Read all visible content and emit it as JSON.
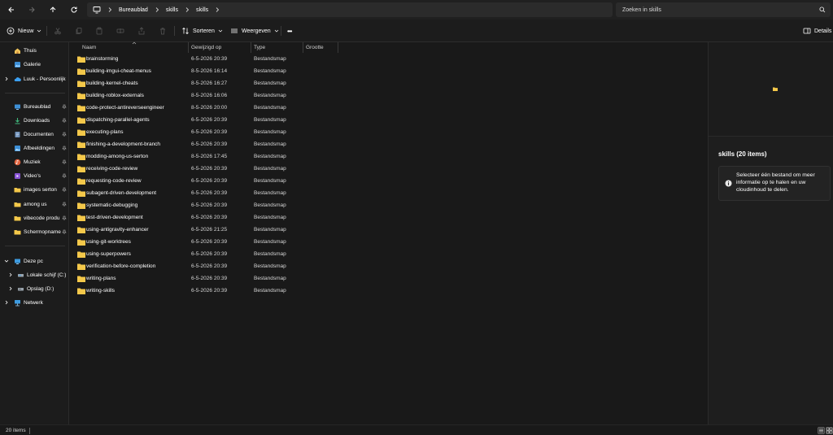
{
  "addressbar": {
    "breadcrumbs": [
      "Bureaublad",
      "skills",
      "skills"
    ],
    "search_placeholder": "Zoeken in skills"
  },
  "commandbar": {
    "new_label": "Nieuw",
    "sort_label": "Sorteren",
    "view_label": "Weergeven",
    "more_label": "•••",
    "details_label": "Details"
  },
  "sidebar": {
    "home": "Thuis",
    "gallery": "Galerie",
    "onedrive": "Luuk - Persoonlijk",
    "quick": [
      {
        "label": "Bureaublad",
        "icon": "desktop-icon"
      },
      {
        "label": "Downloads",
        "icon": "download-icon"
      },
      {
        "label": "Documenten",
        "icon": "document-icon"
      },
      {
        "label": "Afbeeldingen",
        "icon": "pictures-icon"
      },
      {
        "label": "Muziek",
        "icon": "music-icon"
      },
      {
        "label": "Video's",
        "icon": "video-icon"
      },
      {
        "label": "images serton",
        "icon": "folder-icon"
      },
      {
        "label": "among us",
        "icon": "folder-icon"
      },
      {
        "label": "vibecode produ",
        "icon": "folder-icon"
      },
      {
        "label": "Schermopname",
        "icon": "folder-icon"
      }
    ],
    "this_pc": "Deze pc",
    "drives": [
      "Lokale schijf (C:)",
      "Opslag (D:)"
    ],
    "network": "Netwerk"
  },
  "columns": {
    "name": "Naam",
    "modified": "Gewijzigd op",
    "type": "Type",
    "size": "Grootte"
  },
  "files": [
    {
      "name": "brainstorming",
      "modified": "6-5-2026 20:39",
      "type": "Bestandsmap"
    },
    {
      "name": "building-imgui-cheat-menus",
      "modified": "8-5-2026 16:14",
      "type": "Bestandsmap"
    },
    {
      "name": "building-kernel-cheats",
      "modified": "8-5-2026 16:27",
      "type": "Bestandsmap"
    },
    {
      "name": "building-roblox-externals",
      "modified": "8-5-2026 16:06",
      "type": "Bestandsmap"
    },
    {
      "name": "code-protect-antireverseengineer",
      "modified": "8-5-2026 20:00",
      "type": "Bestandsmap"
    },
    {
      "name": "dispatching-parallel-agents",
      "modified": "6-5-2026 20:39",
      "type": "Bestandsmap"
    },
    {
      "name": "executing-plans",
      "modified": "6-5-2026 20:39",
      "type": "Bestandsmap"
    },
    {
      "name": "finishing-a-development-branch",
      "modified": "6-5-2026 20:39",
      "type": "Bestandsmap"
    },
    {
      "name": "modding-among-us-serton",
      "modified": "8-5-2026 17:45",
      "type": "Bestandsmap"
    },
    {
      "name": "receiving-code-review",
      "modified": "6-5-2026 20:39",
      "type": "Bestandsmap"
    },
    {
      "name": "requesting-code-review",
      "modified": "6-5-2026 20:39",
      "type": "Bestandsmap"
    },
    {
      "name": "subagent-driven-development",
      "modified": "6-5-2026 20:39",
      "type": "Bestandsmap"
    },
    {
      "name": "systematic-debugging",
      "modified": "6-5-2026 20:39",
      "type": "Bestandsmap"
    },
    {
      "name": "test-driven-development",
      "modified": "6-5-2026 20:39",
      "type": "Bestandsmap"
    },
    {
      "name": "using-antigravity-enhancer",
      "modified": "6-5-2026 21:25",
      "type": "Bestandsmap"
    },
    {
      "name": "using-git-worktrees",
      "modified": "6-5-2026 20:39",
      "type": "Bestandsmap"
    },
    {
      "name": "using-superpowers",
      "modified": "6-5-2026 20:39",
      "type": "Bestandsmap"
    },
    {
      "name": "verification-before-completion",
      "modified": "6-5-2026 20:39",
      "type": "Bestandsmap"
    },
    {
      "name": "writing-plans",
      "modified": "6-5-2026 20:39",
      "type": "Bestandsmap"
    },
    {
      "name": "writing-skills",
      "modified": "6-5-2026 20:39",
      "type": "Bestandsmap"
    }
  ],
  "details_pane": {
    "title": "skills (20 items)",
    "info": "Selecteer één bestand om meer informatie op te halen en uw cloudinhoud te delen."
  },
  "status": {
    "count": "20 items"
  },
  "colors": {
    "folder": "#f4c84a",
    "background": "#191919",
    "accent": "#4aa3f0"
  }
}
